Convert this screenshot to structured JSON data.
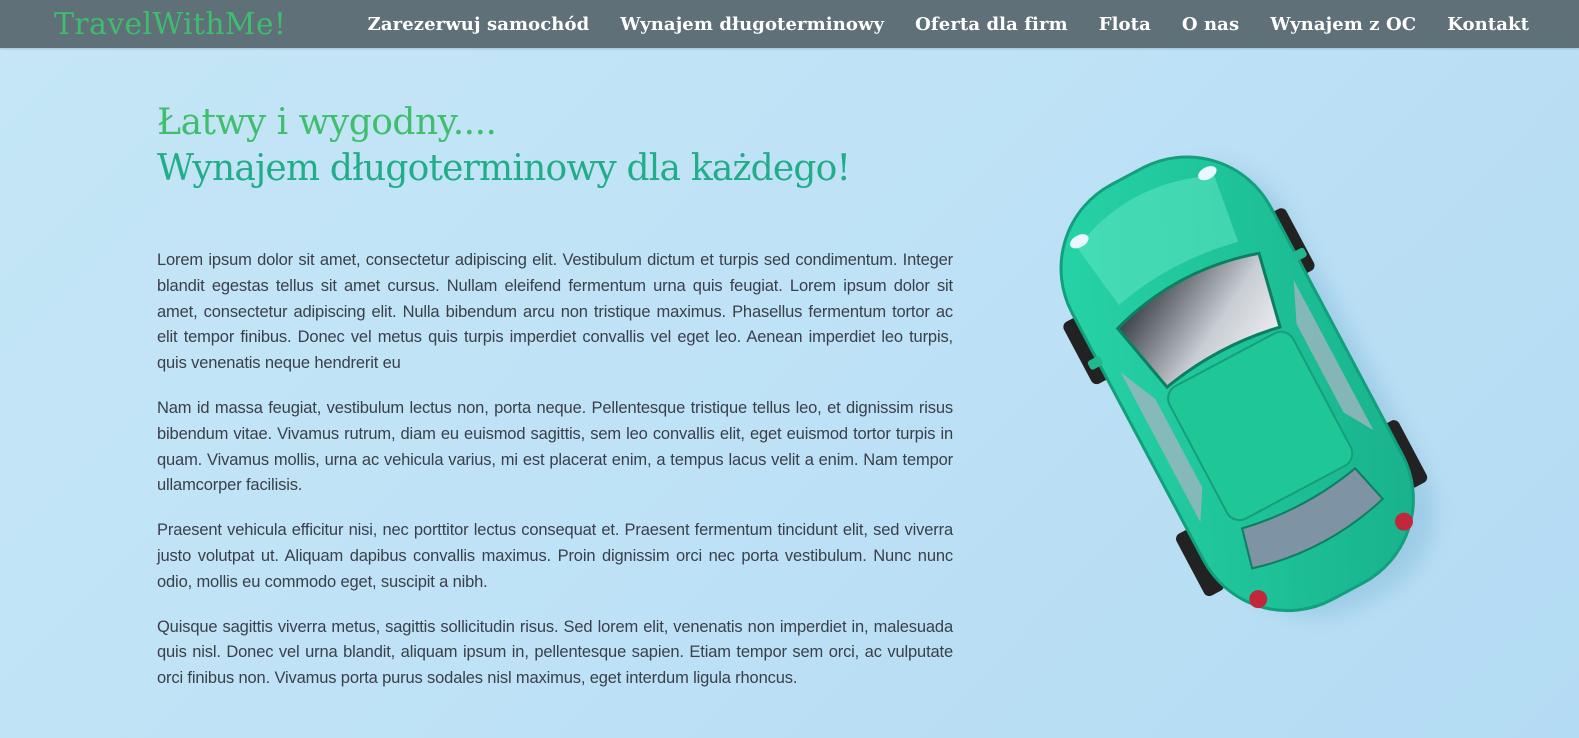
{
  "brand": "TravelWithMe!",
  "nav": [
    "Zarezerwuj samochód",
    "Wynajem długoterminowy",
    "Oferta dla firm",
    "Flota",
    "O nas",
    "Wynajem z OC",
    "Kontakt"
  ],
  "hero": {
    "title_line1": "Łatwy i wygodny....",
    "title_line2": "Wynajem długoterminowy dla każdego!",
    "paragraphs": [
      "Lorem ipsum dolor sit amet, consectetur adipiscing elit. Vestibulum dictum et turpis sed condimentum. Integer blandit egestas tellus sit amet cursus. Nullam eleifend fermentum urna quis feugiat. Lorem ipsum dolor sit amet, consectetur adipiscing elit. Nulla bibendum arcu non tristique maximus. Phasellus fermentum tortor ac elit tempor finibus. Donec vel metus quis turpis imperdiet convallis vel eget leo. Aenean imperdiet leo turpis, quis venenatis neque hendrerit eu",
      "Nam id massa feugiat, vestibulum lectus non, porta neque. Pellentesque tristique tellus leo, et dignissim risus bibendum vitae. Vivamus rutrum, diam eu euismod sagittis, sem leo convallis elit, eget euismod tortor turpis in quam. Vivamus mollis, urna ac vehicula varius, mi est placerat enim, a tempus lacus velit a enim. Nam tempor ullamcorper facilisis.",
      "Praesent vehicula efficitur nisi, nec porttitor lectus consequat et. Praesent fermentum tincidunt elit, sed viverra justo volutpat ut. Aliquam dapibus convallis maximus. Proin dignissim orci nec porta vestibulum. Nunc nunc odio, mollis eu commodo eget, suscipit a nibh.",
      "Quisque sagittis viverra metus, sagittis sollicitudin risus. Sed lorem elit, venenatis non imperdiet in, malesuada quis nisl. Donec vel urna blandit, aliquam ipsum in, pellentesque sapien. Etiam tempor sem orci, ac vulputate orci finibus non. Vivamus porta purus sodales nisl maximus, eget interdum ligula rhoncus."
    ]
  },
  "colors": {
    "navbar": "#5f7079",
    "brand": "#3dbd6d",
    "title_green": "#3fbf6e",
    "title_teal": "#22ad8a",
    "background": "#c4e6f6",
    "car": "#1fc79a"
  },
  "icons": {
    "hero_image": "toy-car-image"
  }
}
